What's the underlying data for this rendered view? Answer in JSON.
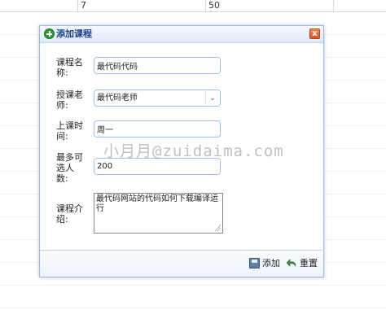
{
  "background": {
    "row_values": [
      "7",
      "50"
    ]
  },
  "dialog": {
    "title": "添加课程",
    "close_label": "x",
    "fields": {
      "course_name": {
        "label": "课程名称:",
        "value": "最代码代码"
      },
      "teacher": {
        "label": "授课老师:",
        "value": "最代码老师"
      },
      "class_time": {
        "label": "上课时间:",
        "value": "周一"
      },
      "max_students": {
        "label": "最多可选人数:",
        "value": "200"
      },
      "intro": {
        "label": "课程介绍:",
        "value": "最代码网站的代码如何下载编译运行"
      }
    },
    "footer": {
      "add_label": "添加",
      "reset_label": "重置"
    }
  },
  "watermark": "小月月@zuidaima.com",
  "colors": {
    "title_text": "#15428b",
    "border": "#9dbbe0",
    "input_border": "#9ec3ea",
    "accent_green": "#2f9b2f",
    "close_orange": "#d9541e"
  },
  "icons": {
    "title": "add-green-plus-icon",
    "close": "close-icon",
    "add": "save-disk-icon",
    "reset": "undo-arrow-icon",
    "select": "chevron-down-icon"
  }
}
